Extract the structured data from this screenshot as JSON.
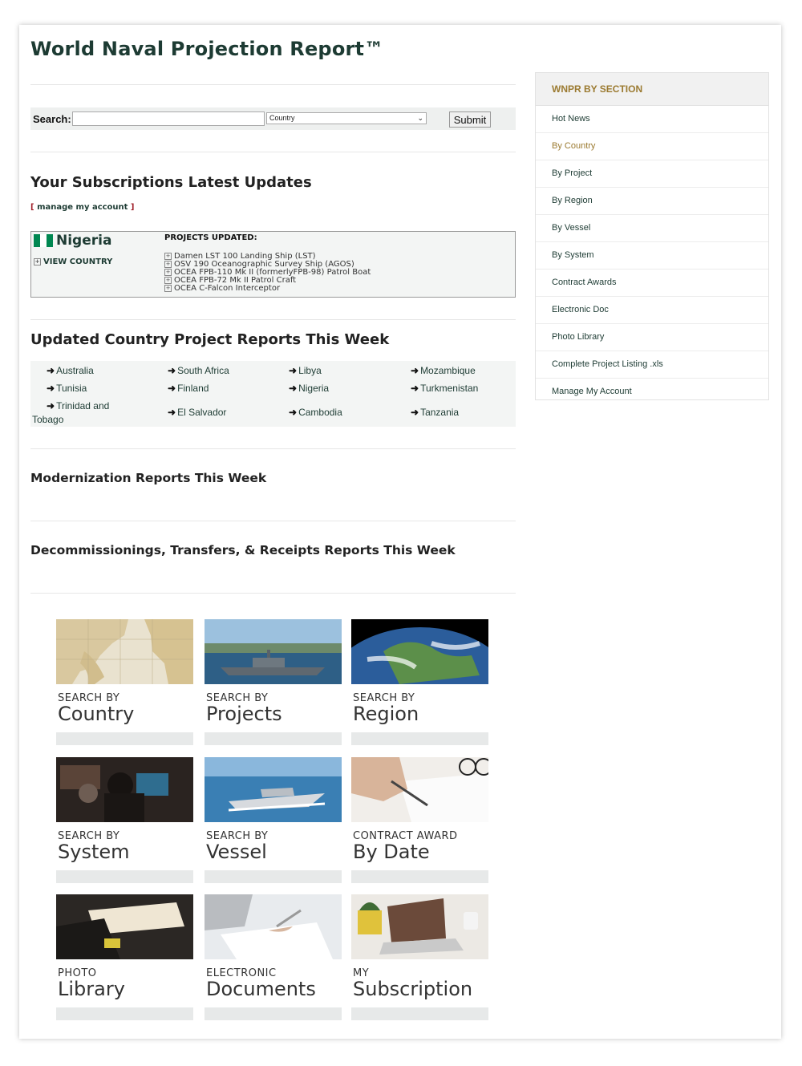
{
  "title": "World Naval Projection Report™",
  "search": {
    "label": "Search:",
    "value": "",
    "country_select": "Country",
    "submit_label": "Submit"
  },
  "subscriptions": {
    "heading": "Your Subscriptions Latest Updates",
    "manage_open": "[ ",
    "manage_label": "manage my account",
    "manage_close": " ]",
    "country": "Nigeria",
    "view_country_label": "VIEW COUNTRY",
    "projects_heading": "PROJECTS UPDATED:",
    "projects": [
      "Damen LST 100 Landing Ship (LST)",
      "OSV 190 Oceanographic Survey Ship (AGOS)",
      "OCEA FPB-110 Mk II (formerlyFPB-98) Patrol Boat",
      "OCEA FPB-72 Mk II Patrol Craft",
      "OCEA C-Falcon Interceptor"
    ]
  },
  "updated_reports": {
    "heading": "Updated Country Project Reports This Week",
    "countries": [
      "Australia",
      "South Africa",
      "Libya",
      "Mozambique",
      "Tunisia",
      "Finland",
      "Nigeria",
      "Turkmenistan",
      "Trinidad and",
      "Tobago",
      "El Salvador",
      "Cambodia",
      "Tanzania"
    ]
  },
  "modernization": {
    "heading": "Modernization Reports This Week"
  },
  "decommissionings": {
    "heading": "Decommissionings, Transfers, & Receipts Reports This Week"
  },
  "tiles": [
    {
      "small": "SEARCH BY",
      "big": "Country"
    },
    {
      "small": "SEARCH BY",
      "big": "Projects"
    },
    {
      "small": "SEARCH BY",
      "big": "Region"
    },
    {
      "small": "SEARCH BY",
      "big": "System"
    },
    {
      "small": "SEARCH BY",
      "big": "Vessel"
    },
    {
      "small": "CONTRACT AWARD",
      "big": "By Date"
    },
    {
      "small": "PHOTO",
      "big": "Library"
    },
    {
      "small": "ELECTRONIC",
      "big": "Documents"
    },
    {
      "small": "MY",
      "big": "Subscription"
    }
  ],
  "sidebar": {
    "heading": "WNPR BY SECTION",
    "items": [
      {
        "label": "Hot News"
      },
      {
        "label": "By Country"
      },
      {
        "label": "By Project"
      },
      {
        "label": "By Region"
      },
      {
        "label": "By Vessel"
      },
      {
        "label": "By System"
      },
      {
        "label": "Contract Awards"
      },
      {
        "label": "Electronic Doc"
      },
      {
        "label": "Photo Library"
      },
      {
        "label": "Complete Project Listing .xls"
      },
      {
        "label": "Manage My Account"
      }
    ]
  },
  "colors": {
    "brand_green": "#1d3b33",
    "accent_gold": "#9b7a30",
    "nigeria_green": "#008751"
  }
}
